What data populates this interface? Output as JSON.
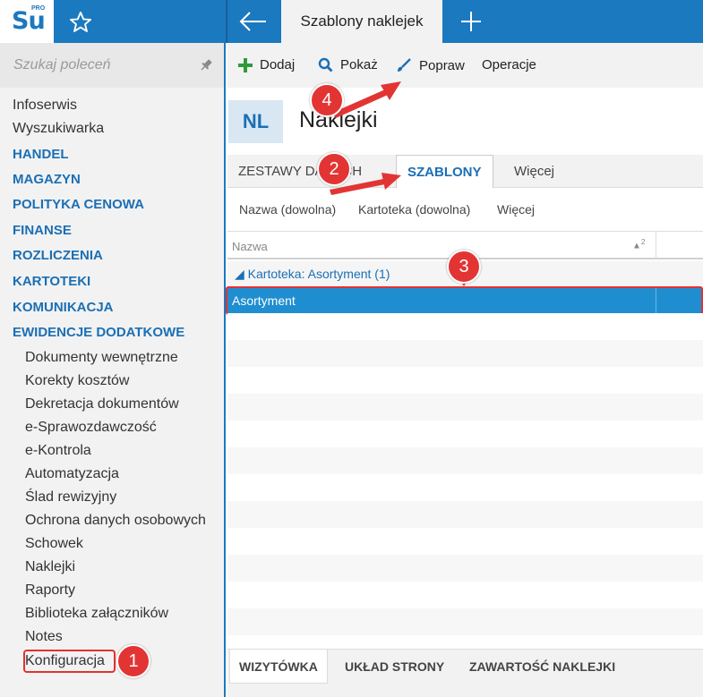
{
  "topbar": {
    "logo_text": "Su",
    "logo_sup": "PRO",
    "active_tab": "Szablony naklejek"
  },
  "sidebar": {
    "search_placeholder": "Szukaj poleceń",
    "items": [
      {
        "label": "Infoserwis",
        "kind": "plain"
      },
      {
        "label": "Wyszukiwarka",
        "kind": "plain"
      },
      {
        "label": "HANDEL",
        "kind": "cat"
      },
      {
        "label": "MAGAZYN",
        "kind": "cat"
      },
      {
        "label": "POLITYKA CENOWA",
        "kind": "cat"
      },
      {
        "label": "FINANSE",
        "kind": "cat"
      },
      {
        "label": "ROZLICZENIA",
        "kind": "cat"
      },
      {
        "label": "KARTOTEKI",
        "kind": "cat"
      },
      {
        "label": "KOMUNIKACJA",
        "kind": "cat"
      },
      {
        "label": "EWIDENCJE DODATKOWE",
        "kind": "cat"
      },
      {
        "label": "Dokumenty wewnętrzne",
        "kind": "sub"
      },
      {
        "label": "Korekty kosztów",
        "kind": "sub"
      },
      {
        "label": "Dekretacja dokumentów",
        "kind": "sub"
      },
      {
        "label": "e-Sprawozdawczość",
        "kind": "sub"
      },
      {
        "label": "e-Kontrola",
        "kind": "sub"
      },
      {
        "label": "Automatyzacja",
        "kind": "sub"
      },
      {
        "label": "Ślad rewizyjny",
        "kind": "sub"
      },
      {
        "label": "Ochrona danych osobowych",
        "kind": "sub"
      },
      {
        "label": "Schowek",
        "kind": "sub"
      },
      {
        "label": "Naklejki",
        "kind": "sub"
      },
      {
        "label": "Raporty",
        "kind": "sub"
      },
      {
        "label": "Biblioteka załączników",
        "kind": "sub"
      },
      {
        "label": "Notes",
        "kind": "sub"
      },
      {
        "label": "Konfiguracja",
        "kind": "sub"
      }
    ]
  },
  "toolbar": {
    "add": "Dodaj",
    "show": "Pokaż",
    "edit": "Popraw",
    "operations": "Operacje"
  },
  "header": {
    "badge": "NL",
    "title": "Naklejki"
  },
  "tabs": {
    "sets": "ZESTAWY DANYCH",
    "templates": "SZABLONY",
    "more": "Więcej"
  },
  "filters": {
    "name": "Nazwa (dowolna)",
    "card": "Kartoteka (dowolna)",
    "more": "Więcej"
  },
  "grid": {
    "column": "Nazwa",
    "sort_index": "2",
    "group": "Kartoteka: Asortyment",
    "group_count": "(1)",
    "rows": [
      "Asortyment"
    ]
  },
  "bottom_tabs": {
    "card": "WIZYTÓWKA",
    "layout": "UKŁAD STRONY",
    "content": "ZAWARTOŚĆ NAKLEJKI"
  },
  "callouts": [
    "1",
    "2",
    "3",
    "4"
  ],
  "colors": {
    "accent": "#1b79bf",
    "selection": "#1f8ed1",
    "callout": "#e33434",
    "add_icon": "#2e9a3c"
  }
}
